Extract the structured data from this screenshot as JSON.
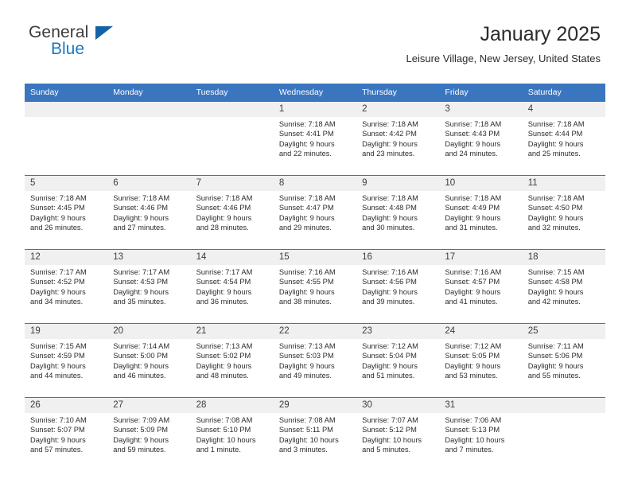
{
  "brand": {
    "name_part1": "General",
    "name_part2": "Blue",
    "accent_color": "#1878c4",
    "triangle_color": "#1262a8"
  },
  "header": {
    "title": "January 2025",
    "subtitle": "Leisure Village, New Jersey, United States"
  },
  "theme": {
    "header_bg": "#3a76bf",
    "header_text": "#ffffff",
    "daynum_bg": "#f0f0f0",
    "cell_bg": "#ffffff",
    "row_separator": "#3a76bf"
  },
  "calendar": {
    "weekdays": [
      "Sunday",
      "Monday",
      "Tuesday",
      "Wednesday",
      "Thursday",
      "Friday",
      "Saturday"
    ],
    "weeks": [
      [
        {
          "day": "",
          "lines": []
        },
        {
          "day": "",
          "lines": []
        },
        {
          "day": "",
          "lines": []
        },
        {
          "day": "1",
          "lines": [
            "Sunrise: 7:18 AM",
            "Sunset: 4:41 PM",
            "Daylight: 9 hours",
            "and 22 minutes."
          ]
        },
        {
          "day": "2",
          "lines": [
            "Sunrise: 7:18 AM",
            "Sunset: 4:42 PM",
            "Daylight: 9 hours",
            "and 23 minutes."
          ]
        },
        {
          "day": "3",
          "lines": [
            "Sunrise: 7:18 AM",
            "Sunset: 4:43 PM",
            "Daylight: 9 hours",
            "and 24 minutes."
          ]
        },
        {
          "day": "4",
          "lines": [
            "Sunrise: 7:18 AM",
            "Sunset: 4:44 PM",
            "Daylight: 9 hours",
            "and 25 minutes."
          ]
        }
      ],
      [
        {
          "day": "5",
          "lines": [
            "Sunrise: 7:18 AM",
            "Sunset: 4:45 PM",
            "Daylight: 9 hours",
            "and 26 minutes."
          ]
        },
        {
          "day": "6",
          "lines": [
            "Sunrise: 7:18 AM",
            "Sunset: 4:46 PM",
            "Daylight: 9 hours",
            "and 27 minutes."
          ]
        },
        {
          "day": "7",
          "lines": [
            "Sunrise: 7:18 AM",
            "Sunset: 4:46 PM",
            "Daylight: 9 hours",
            "and 28 minutes."
          ]
        },
        {
          "day": "8",
          "lines": [
            "Sunrise: 7:18 AM",
            "Sunset: 4:47 PM",
            "Daylight: 9 hours",
            "and 29 minutes."
          ]
        },
        {
          "day": "9",
          "lines": [
            "Sunrise: 7:18 AM",
            "Sunset: 4:48 PM",
            "Daylight: 9 hours",
            "and 30 minutes."
          ]
        },
        {
          "day": "10",
          "lines": [
            "Sunrise: 7:18 AM",
            "Sunset: 4:49 PM",
            "Daylight: 9 hours",
            "and 31 minutes."
          ]
        },
        {
          "day": "11",
          "lines": [
            "Sunrise: 7:18 AM",
            "Sunset: 4:50 PM",
            "Daylight: 9 hours",
            "and 32 minutes."
          ]
        }
      ],
      [
        {
          "day": "12",
          "lines": [
            "Sunrise: 7:17 AM",
            "Sunset: 4:52 PM",
            "Daylight: 9 hours",
            "and 34 minutes."
          ]
        },
        {
          "day": "13",
          "lines": [
            "Sunrise: 7:17 AM",
            "Sunset: 4:53 PM",
            "Daylight: 9 hours",
            "and 35 minutes."
          ]
        },
        {
          "day": "14",
          "lines": [
            "Sunrise: 7:17 AM",
            "Sunset: 4:54 PM",
            "Daylight: 9 hours",
            "and 36 minutes."
          ]
        },
        {
          "day": "15",
          "lines": [
            "Sunrise: 7:16 AM",
            "Sunset: 4:55 PM",
            "Daylight: 9 hours",
            "and 38 minutes."
          ]
        },
        {
          "day": "16",
          "lines": [
            "Sunrise: 7:16 AM",
            "Sunset: 4:56 PM",
            "Daylight: 9 hours",
            "and 39 minutes."
          ]
        },
        {
          "day": "17",
          "lines": [
            "Sunrise: 7:16 AM",
            "Sunset: 4:57 PM",
            "Daylight: 9 hours",
            "and 41 minutes."
          ]
        },
        {
          "day": "18",
          "lines": [
            "Sunrise: 7:15 AM",
            "Sunset: 4:58 PM",
            "Daylight: 9 hours",
            "and 42 minutes."
          ]
        }
      ],
      [
        {
          "day": "19",
          "lines": [
            "Sunrise: 7:15 AM",
            "Sunset: 4:59 PM",
            "Daylight: 9 hours",
            "and 44 minutes."
          ]
        },
        {
          "day": "20",
          "lines": [
            "Sunrise: 7:14 AM",
            "Sunset: 5:00 PM",
            "Daylight: 9 hours",
            "and 46 minutes."
          ]
        },
        {
          "day": "21",
          "lines": [
            "Sunrise: 7:13 AM",
            "Sunset: 5:02 PM",
            "Daylight: 9 hours",
            "and 48 minutes."
          ]
        },
        {
          "day": "22",
          "lines": [
            "Sunrise: 7:13 AM",
            "Sunset: 5:03 PM",
            "Daylight: 9 hours",
            "and 49 minutes."
          ]
        },
        {
          "day": "23",
          "lines": [
            "Sunrise: 7:12 AM",
            "Sunset: 5:04 PM",
            "Daylight: 9 hours",
            "and 51 minutes."
          ]
        },
        {
          "day": "24",
          "lines": [
            "Sunrise: 7:12 AM",
            "Sunset: 5:05 PM",
            "Daylight: 9 hours",
            "and 53 minutes."
          ]
        },
        {
          "day": "25",
          "lines": [
            "Sunrise: 7:11 AM",
            "Sunset: 5:06 PM",
            "Daylight: 9 hours",
            "and 55 minutes."
          ]
        }
      ],
      [
        {
          "day": "26",
          "lines": [
            "Sunrise: 7:10 AM",
            "Sunset: 5:07 PM",
            "Daylight: 9 hours",
            "and 57 minutes."
          ]
        },
        {
          "day": "27",
          "lines": [
            "Sunrise: 7:09 AM",
            "Sunset: 5:09 PM",
            "Daylight: 9 hours",
            "and 59 minutes."
          ]
        },
        {
          "day": "28",
          "lines": [
            "Sunrise: 7:08 AM",
            "Sunset: 5:10 PM",
            "Daylight: 10 hours",
            "and 1 minute."
          ]
        },
        {
          "day": "29",
          "lines": [
            "Sunrise: 7:08 AM",
            "Sunset: 5:11 PM",
            "Daylight: 10 hours",
            "and 3 minutes."
          ]
        },
        {
          "day": "30",
          "lines": [
            "Sunrise: 7:07 AM",
            "Sunset: 5:12 PM",
            "Daylight: 10 hours",
            "and 5 minutes."
          ]
        },
        {
          "day": "31",
          "lines": [
            "Sunrise: 7:06 AM",
            "Sunset: 5:13 PM",
            "Daylight: 10 hours",
            "and 7 minutes."
          ]
        },
        {
          "day": "",
          "lines": []
        }
      ]
    ]
  }
}
